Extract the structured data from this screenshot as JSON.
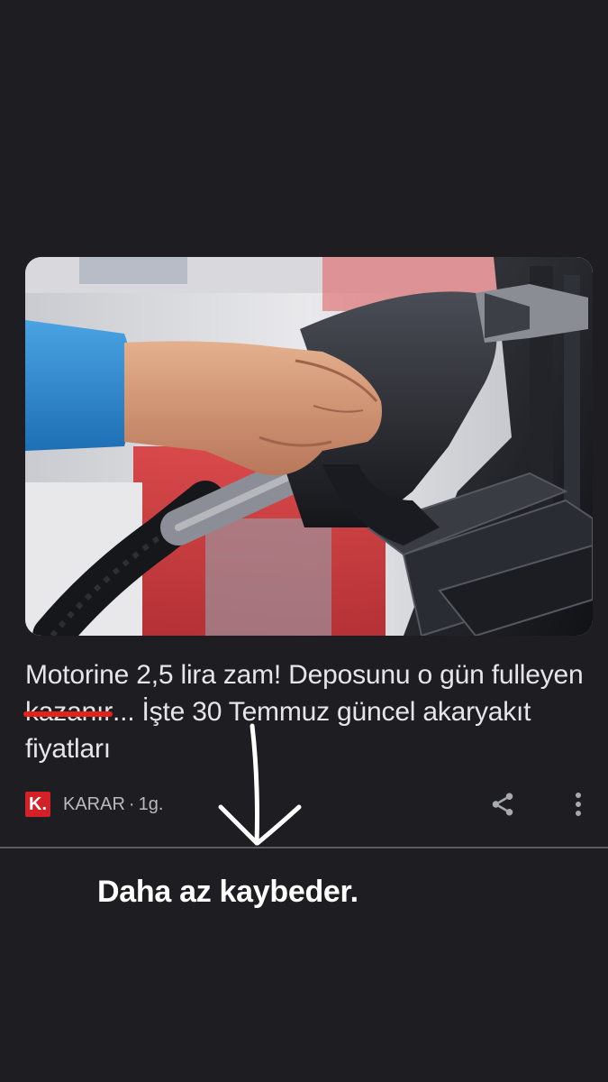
{
  "article": {
    "headline_part1": "Motorine 2,5 lira zam! Deposunu o gün fulleyen ",
    "headline_struck": "kazanır",
    "headline_part2": "... İşte 30 Temmuz güncel akaryakıt fiyatları",
    "image_description_icon": "fuel-pump-photo",
    "source": {
      "logo_text": "K.",
      "name": "KARAR",
      "separator": "·",
      "age": "1g.",
      "brand_color": "#d42027"
    },
    "actions": {
      "share_icon": "share-icon",
      "more_icon": "more-vert-icon"
    }
  },
  "annotation": {
    "arrow_icon": "hand-drawn-down-arrow-icon",
    "caption": "Daha az kaybeder.",
    "strike_color": "#e2231a"
  },
  "colors": {
    "background": "#1d1d22",
    "text": "#e6e6ea",
    "meta_text": "#b9b9c0",
    "divider": "#5c5c62"
  }
}
